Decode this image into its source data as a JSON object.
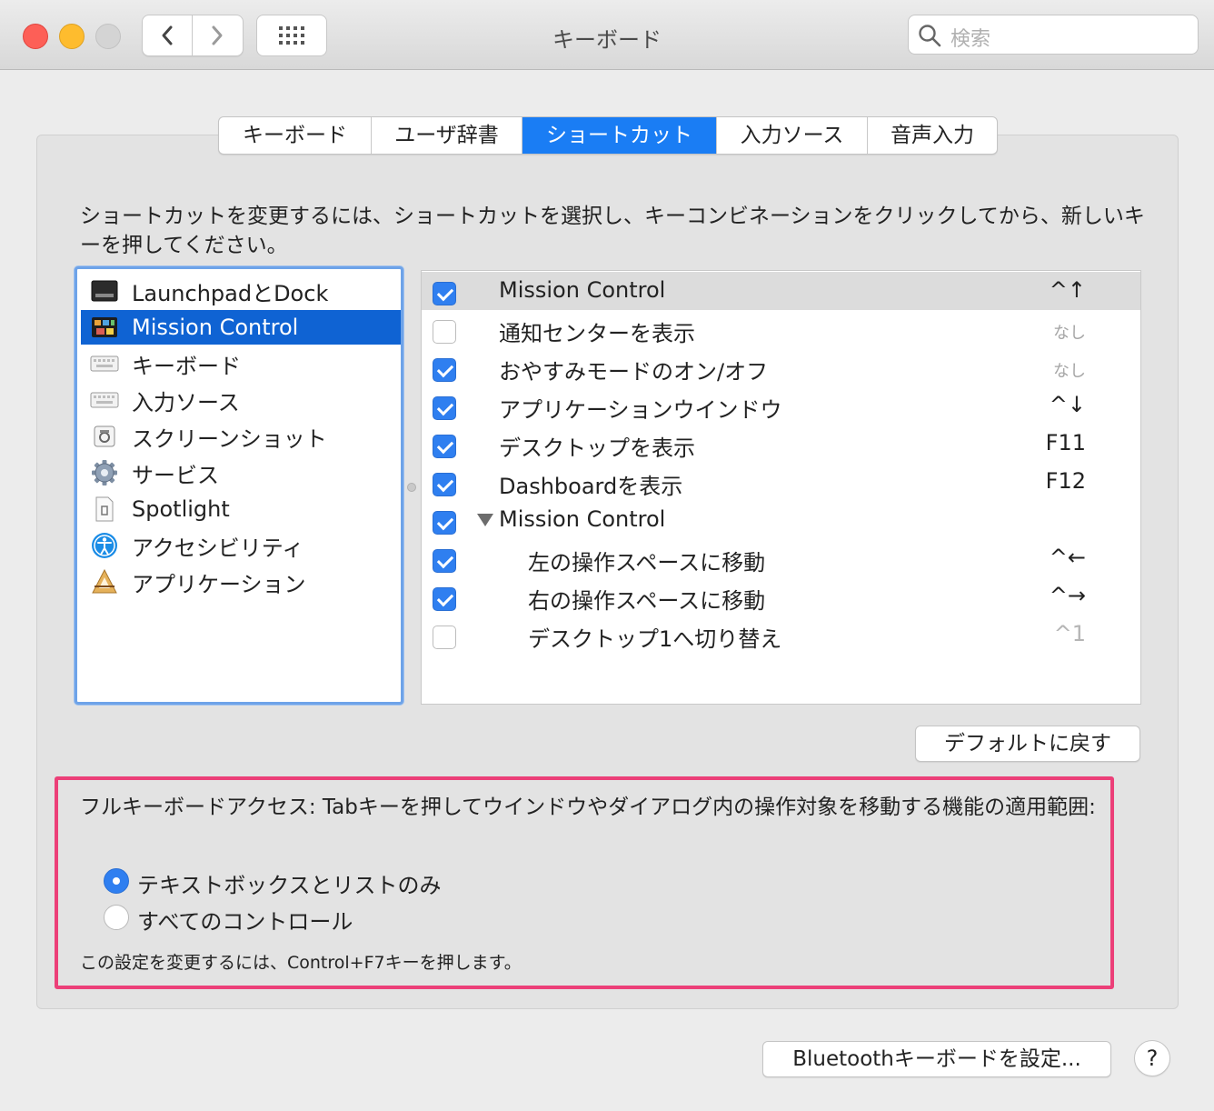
{
  "window": {
    "title": "キーボード",
    "search_placeholder": "検索",
    "icons": {
      "back": "chevron-left-icon",
      "forward": "chevron-right-icon",
      "grid": "grid-icon",
      "search": "search-icon"
    }
  },
  "tabs": [
    {
      "label": "キーボード",
      "active": false
    },
    {
      "label": "ユーザ辞書",
      "active": false
    },
    {
      "label": "ショートカット",
      "active": true
    },
    {
      "label": "入力ソース",
      "active": false
    },
    {
      "label": "音声入力",
      "active": false
    }
  ],
  "description": "ショートカットを変更するには、ショートカットを選択し、キーコンビネーションをクリックしてから、新しいキーを押してください。",
  "categories": [
    {
      "label": "LaunchpadとDock",
      "icon": "launchpad-dock-icon",
      "selected": false
    },
    {
      "label": "Mission Control",
      "icon": "mission-control-icon",
      "selected": true
    },
    {
      "label": "キーボード",
      "icon": "keyboard-icon",
      "selected": false
    },
    {
      "label": "入力ソース",
      "icon": "input-sources-icon",
      "selected": false
    },
    {
      "label": "スクリーンショット",
      "icon": "screenshot-icon",
      "selected": false
    },
    {
      "label": "サービス",
      "icon": "services-gear-icon",
      "selected": false
    },
    {
      "label": "Spotlight",
      "icon": "spotlight-icon",
      "selected": false
    },
    {
      "label": "アクセシビリティ",
      "icon": "accessibility-icon",
      "selected": false
    },
    {
      "label": "アプリケーション",
      "icon": "applications-icon",
      "selected": false
    }
  ],
  "shortcuts": [
    {
      "label": "Mission Control",
      "key": "^↑",
      "checked": true,
      "highlighted": true
    },
    {
      "label": "通知センターを表示",
      "key": "なし",
      "checked": false
    },
    {
      "label": "おやすみモードのオン/オフ",
      "key": "なし",
      "checked": true
    },
    {
      "label": "アプリケーションウインドウ",
      "key": "^↓",
      "checked": true
    },
    {
      "label": "デスクトップを表示",
      "key": "F11",
      "checked": true
    },
    {
      "label": "Dashboardを表示",
      "key": "F12",
      "checked": true
    },
    {
      "label": "Mission Control",
      "key": "",
      "checked": true,
      "group": true
    },
    {
      "label": "左の操作スペースに移動",
      "key": "^←",
      "checked": true,
      "indent": true
    },
    {
      "label": "右の操作スペースに移動",
      "key": "^→",
      "checked": true,
      "indent": true
    },
    {
      "label": "デスクトップ1へ切り替え",
      "key": "^1",
      "checked": false,
      "indent": true
    }
  ],
  "reset_button": "デフォルトに戻す",
  "full_keyboard_access": {
    "title": "フルキーボードアクセス: Tabキーを押してウインドウやダイアログ内の操作対象を移動する機能の適用範囲:",
    "options": [
      {
        "label": "テキストボックスとリストのみ",
        "selected": true
      },
      {
        "label": "すべてのコントロール",
        "selected": false
      }
    ],
    "note": "この設定を変更するには、Control+F7キーを押します。"
  },
  "bluetooth_button": "Bluetoothキーボードを設定...",
  "help_button": "?",
  "colors": {
    "accent": "#1a7df4",
    "selection": "#0f63d3",
    "highlight_border": "#ec3f78"
  }
}
